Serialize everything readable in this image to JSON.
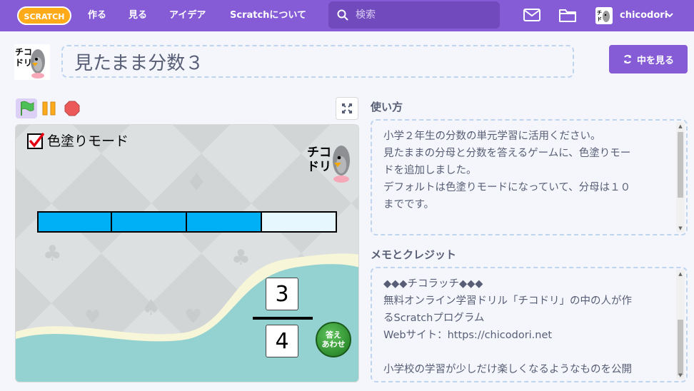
{
  "nav": {
    "logo_text": "SCRATCH",
    "create": "作る",
    "explore": "見る",
    "ideas": "アイデア",
    "about": "Scratchについて",
    "search_placeholder": "検索",
    "username": "chicodori"
  },
  "project": {
    "title": "見たまま分数３",
    "see_inside": "中を見る",
    "author_logo_text": "チコドリ"
  },
  "stage": {
    "color_mode_label": "色塗りモード",
    "color_mode_checked": true,
    "bar_total_parts": 4,
    "bar_filled_parts": 3,
    "bar_filled_color": "#00b0f6",
    "bar_empty_color": "#e6f7fe",
    "numerator": "3",
    "denominator": "4",
    "answer_button_line1": "答え",
    "answer_button_line2": "あわせ"
  },
  "instructions": {
    "label": "使い方",
    "lines": [
      "小学２年生の分数の単元学習に活用ください。",
      "見たままの分母と分数を答えるゲームに、色塗りモー",
      "ドを追加しました。",
      "デフォルトは色塗りモードになっていて、分母は１０",
      "までです。"
    ]
  },
  "notes": {
    "label": "メモとクレジット",
    "lines": [
      "◆◆◆チコラッチ◆◆◆",
      "無料オンライン学習ドリル「チコドリ」の中の人が作",
      "るScratchプログラム",
      "Webサイト：https://chicodori.net",
      "",
      "小学校の学習が少しだけ楽しくなるようなものを公開"
    ]
  },
  "colors": {
    "nav_purple": "#855cd6",
    "search_purple": "#714bbd",
    "answer_green": "#2f8f30"
  }
}
